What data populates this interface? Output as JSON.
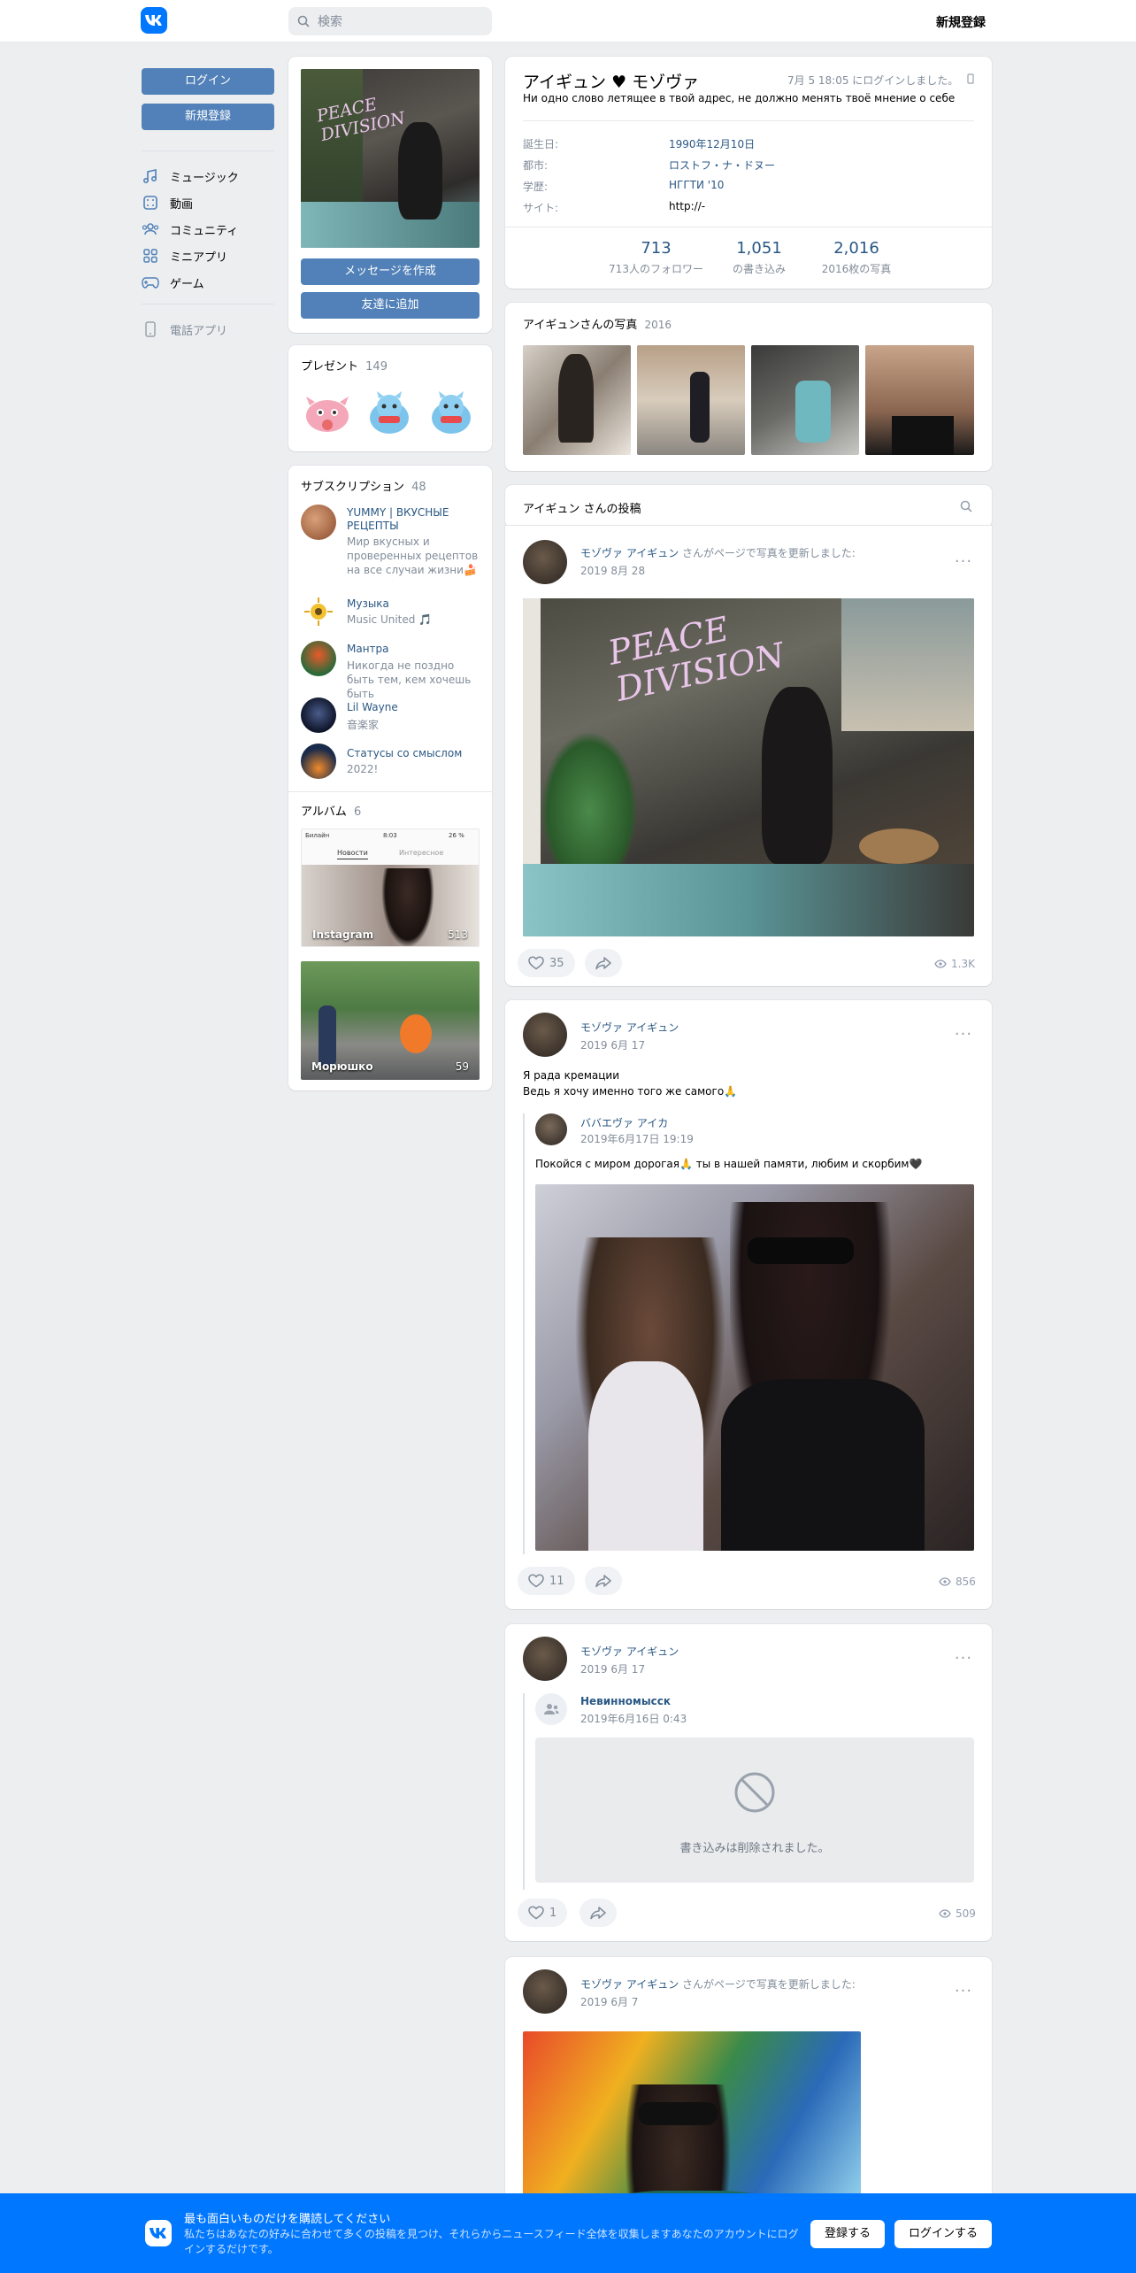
{
  "header": {
    "search_placeholder": "検索",
    "register": "新規登録"
  },
  "sidebar": {
    "login": "ログイン",
    "register": "新規登録",
    "items": [
      {
        "label": "ミュージック",
        "icon": "music-icon"
      },
      {
        "label": "動画",
        "icon": "video-icon"
      },
      {
        "label": "コミュニティ",
        "icon": "community-icon"
      },
      {
        "label": "ミニアプリ",
        "icon": "apps-icon"
      },
      {
        "label": "ゲーム",
        "icon": "games-icon"
      }
    ],
    "phone_app": "電話アプリ"
  },
  "profile_left": {
    "message_btn": "メッセージを作成",
    "add_friend_btn": "友達に追加",
    "avatar_text": "PEACE DIVISION"
  },
  "gifts": {
    "title": "プレゼント",
    "count": "149"
  },
  "subscriptions": {
    "title": "サブスクリプション",
    "count": "48",
    "items": [
      {
        "name": "YUMMY | ВКУСНЫЕ РЕЦЕПТЫ",
        "desc": "Мир вкусных и проверенных рецептов на все случаи жизни🍰"
      },
      {
        "name": "Музыка",
        "desc": "Music United 🎵"
      },
      {
        "name": "Мантра",
        "desc": "Никогда не поздно быть тем, кем хочешь быть"
      },
      {
        "name": "Lil Wayne",
        "desc": "音楽家"
      },
      {
        "name": "Статусы со смыслом",
        "desc": "2022!"
      }
    ]
  },
  "albums": {
    "title": "アルバム",
    "count": "6",
    "items": [
      {
        "name": "Instagram",
        "count": "513"
      },
      {
        "name": "Морюшко",
        "count": "59"
      }
    ],
    "insta_ui": {
      "carrier": "Билайн",
      "time": "8:03",
      "battery": "26 %",
      "tab1": "Новости",
      "tab2": "Интересное"
    }
  },
  "profile": {
    "name": "アイギュン ♥ モゾヴァ",
    "last_seen": "7月 5 18:05 にログインしました。",
    "status": "Ни одно слово летящее в твой адрес, не должно менять твоё мнение о себе",
    "fields": [
      {
        "label": "誕生日:",
        "value": "1990年12月10日"
      },
      {
        "label": "都市:",
        "value": "ロストフ・ナ・ドヌー"
      },
      {
        "label": "学歴:",
        "value": "НГГТИ '10"
      },
      {
        "label": "サイト:",
        "value": "http://-"
      }
    ],
    "counters": [
      {
        "num": "713",
        "label": "713人のフォロワー"
      },
      {
        "num": "1,051",
        "label": "の書き込み"
      },
      {
        "num": "2,016",
        "label": "2016枚の写真"
      }
    ]
  },
  "photos": {
    "title": "アイギュンさんの写真",
    "count": "2016"
  },
  "wall": {
    "tab": "アイギュン さんの投稿"
  },
  "posts": [
    {
      "author": "モゾヴァ アイギュン",
      "action": "さんがページで写真を更新しました:",
      "date": "2019 8月 28",
      "likes": "35",
      "views": "1.3K"
    },
    {
      "author": "モゾヴァ アイギュン",
      "date": "2019 6月 17",
      "text1": "Я рада кремации",
      "text2": "Ведь я хочу именно того же самого🙏",
      "repost_author": "ババエヴァ アイカ",
      "repost_date": "2019年6月17日 19:19",
      "repost_text": "Покойся с миром дорогая🙏 ты в нашей памяти, любим и скорбим🖤",
      "likes": "11",
      "views": "856"
    },
    {
      "author": "モゾヴァ アイギュン",
      "date": "2019 6月 17",
      "repost_author": "Невинномысск",
      "repost_date": "2019年6月16日 0:43",
      "deleted": "書き込みは削除されました。",
      "likes": "1",
      "views": "509"
    },
    {
      "author": "モゾヴァ アイギュン",
      "action": "さんがページで写真を更新しました:",
      "date": "2019 6月 7"
    }
  ],
  "banner": {
    "title": "最も面白いものだけを購読してください",
    "text": "私たちはあなたの好みに合わせて多くの投稿を見つけ、それらからニュースフィード全体を収集しますあなたのアカウントにログインするだけです。",
    "register": "登録する",
    "login": "ログインする"
  },
  "colors": {
    "accent": "#5181b8",
    "vk_blue": "#0077ff",
    "link": "#2a5885",
    "bg": "#edeef0"
  }
}
